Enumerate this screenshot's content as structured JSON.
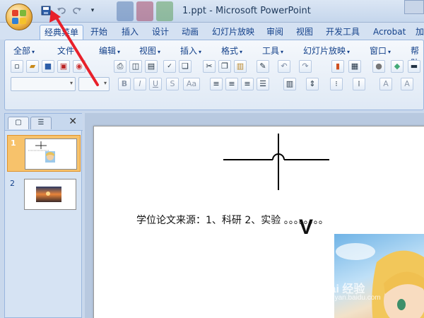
{
  "window": {
    "title": "1.ppt - Microsoft PowerPoint"
  },
  "ribbon_tabs": [
    {
      "label": "经典菜单",
      "active": true
    },
    {
      "label": "开始"
    },
    {
      "label": "插入"
    },
    {
      "label": "设计"
    },
    {
      "label": "动画"
    },
    {
      "label": "幻灯片放映"
    },
    {
      "label": "审阅"
    },
    {
      "label": "视图"
    },
    {
      "label": "开发工具"
    },
    {
      "label": "Acrobat"
    },
    {
      "label": "加"
    }
  ],
  "menu": [
    {
      "label": "全部"
    },
    {
      "label": "文件"
    },
    {
      "label": "编辑"
    },
    {
      "label": "视图"
    },
    {
      "label": "插入"
    },
    {
      "label": "格式"
    },
    {
      "label": "工具"
    },
    {
      "label": "幻灯片放映"
    },
    {
      "label": "窗口"
    },
    {
      "label": "帮助"
    }
  ],
  "format_buttons": {
    "bold": "B",
    "italic": "I",
    "underline": "U",
    "shadow": "S",
    "case": "Aa"
  },
  "slides_pane": {
    "slides": [
      {
        "number": "1",
        "selected": true
      },
      {
        "number": "2",
        "selected": false
      }
    ]
  },
  "slide": {
    "body_text": "学位论文来源：1、科研  2、实验  。。。。。。。。",
    "mark": "V"
  },
  "watermark": {
    "brand": "Bai 经验",
    "url": "jingyan.baidu.com"
  },
  "colors": {
    "accent": "#15428b",
    "selection": "#f7c26b",
    "annotation_arrow": "#e8202a"
  }
}
